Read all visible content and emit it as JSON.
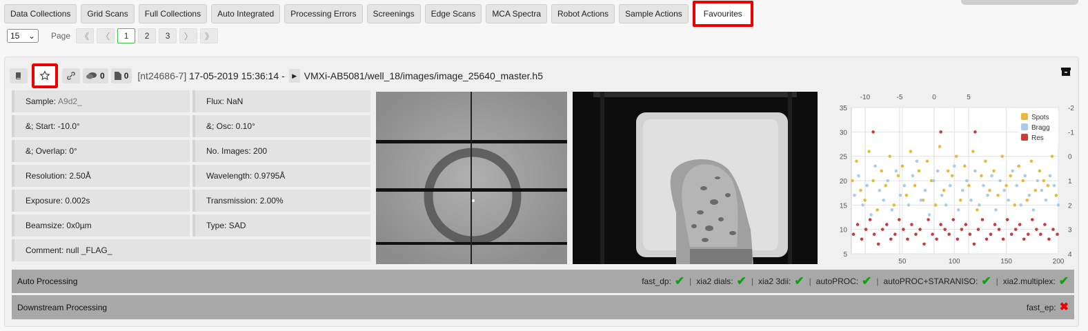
{
  "tabs": [
    "Data Collections",
    "Grid Scans",
    "Full Collections",
    "Auto Integrated",
    "Processing Errors",
    "Screenings",
    "Edge Scans",
    "MCA Spectra",
    "Robot Actions",
    "Sample Actions",
    "Favourites"
  ],
  "pager": {
    "per_page": "15",
    "label": "Page",
    "pages": [
      "1",
      "2",
      "3"
    ],
    "first": "《",
    "prev": "〈",
    "next": "〉",
    "last": "》"
  },
  "header": {
    "comments": "0",
    "attachments": "0",
    "code": "[nt24686-7]",
    "datetime": "17-05-2019 15:36:14 -",
    "path": "VMXi-AB5081/well_18/images/image_25640_master.h5"
  },
  "details": {
    "sample_label": "Sample:",
    "sample_value": "A9d2_",
    "flux": "Flux: NaN",
    "start": "&; Start: -10.0°",
    "osc": "&; Osc: 0.10°",
    "overlap": "&; Overlap: 0°",
    "images": "No. Images: 200",
    "resolution": "Resolution: 2.50Å",
    "wavelength": "Wavelength: 0.9795Å",
    "exposure": "Exposure: 0.002s",
    "transmission": "Transmission: 2.00%",
    "beamsize": "Beamsize: 0x0µm",
    "type": "Type: SAD",
    "comment": "Comment: null _FLAG_"
  },
  "auto_processing": {
    "title": "Auto Processing",
    "items": [
      "fast_dp:",
      "xia2 dials:",
      "xia2 3dii:",
      "autoPROC:",
      "autoPROC+STARANISO:",
      "xia2.multiplex:"
    ]
  },
  "downstream": {
    "title": "Downstream Processing",
    "items": [
      "fast_ep:"
    ]
  },
  "chart_data": {
    "type": "scatter",
    "x_ticks": [
      "50",
      "100",
      "150",
      "200"
    ],
    "x_top_ticks": [
      "-10",
      "-5",
      "0",
      "5"
    ],
    "y_left_ticks": [
      "35",
      "30",
      "25",
      "20",
      "15",
      "10",
      "5"
    ],
    "y_right_ticks": [
      "-2",
      "-1",
      "0",
      "1",
      "2",
      "3",
      "4"
    ],
    "xlim": [
      1,
      200
    ],
    "ylim": [
      5,
      35
    ],
    "legend": [
      "Spots",
      "Bragg",
      "Res"
    ],
    "colors": {
      "Spots": "#e8b93a",
      "Bragg": "#a9cce8",
      "Res": "#c93c3c"
    },
    "series": [
      {
        "name": "Spots",
        "x": [
          2,
          6,
          10,
          14,
          18,
          22,
          26,
          30,
          34,
          38,
          42,
          46,
          50,
          54,
          58,
          62,
          66,
          70,
          74,
          78,
          82,
          86,
          90,
          94,
          98,
          102,
          106,
          110,
          114,
          118,
          122,
          126,
          130,
          134,
          138,
          142,
          146,
          150,
          154,
          158,
          162,
          166,
          170,
          174,
          178,
          182,
          186,
          190,
          194,
          198
        ],
        "y": [
          20,
          24,
          18,
          16,
          26,
          20,
          14,
          22,
          19,
          25,
          15,
          21,
          23,
          17,
          26,
          19,
          22,
          16,
          24,
          20,
          15,
          27,
          18,
          22,
          21,
          25,
          16,
          23,
          19,
          26,
          14,
          21,
          24,
          18,
          22,
          17,
          25,
          19,
          21,
          15,
          23,
          20,
          16,
          24,
          18,
          22,
          20,
          19,
          25,
          17
        ]
      },
      {
        "name": "Bragg",
        "x": [
          4,
          8,
          12,
          16,
          20,
          24,
          28,
          32,
          36,
          40,
          44,
          48,
          52,
          56,
          60,
          64,
          68,
          72,
          76,
          80,
          84,
          88,
          92,
          96,
          100,
          104,
          108,
          112,
          116,
          120,
          124,
          128,
          132,
          136,
          140,
          144,
          148,
          152,
          156,
          160,
          164,
          168,
          172,
          176,
          180,
          184,
          188,
          192,
          196,
          200
        ],
        "y": [
          17,
          21,
          15,
          19,
          13,
          23,
          18,
          16,
          20,
          14,
          22,
          17,
          19,
          15,
          21,
          24,
          16,
          18,
          13,
          20,
          22,
          17,
          15,
          19,
          23,
          14,
          18,
          20,
          16,
          22,
          15,
          19,
          17,
          21,
          14,
          20,
          18,
          16,
          22,
          19,
          15,
          21,
          17,
          14,
          20,
          18,
          16,
          21,
          19,
          15
        ]
      },
      {
        "name": "Res",
        "x": [
          3,
          7,
          11,
          15,
          19,
          23,
          27,
          31,
          35,
          39,
          43,
          47,
          51,
          55,
          59,
          63,
          67,
          71,
          75,
          79,
          83,
          87,
          91,
          95,
          99,
          103,
          107,
          111,
          115,
          119,
          123,
          127,
          131,
          135,
          139,
          143,
          147,
          151,
          155,
          159,
          163,
          167,
          171,
          175,
          179,
          183,
          187,
          191,
          195,
          199,
          22,
          87,
          120
        ],
        "y": [
          9,
          11,
          8,
          10,
          12,
          9,
          7,
          10,
          11,
          8,
          9,
          12,
          10,
          8,
          11,
          9,
          10,
          7,
          12,
          9,
          8,
          11,
          10,
          9,
          12,
          8,
          10,
          11,
          9,
          7,
          10,
          12,
          8,
          9,
          11,
          10,
          8,
          12,
          9,
          10,
          11,
          8,
          9,
          12,
          10,
          9,
          11,
          8,
          10,
          9,
          30,
          30,
          30
        ]
      }
    ]
  }
}
